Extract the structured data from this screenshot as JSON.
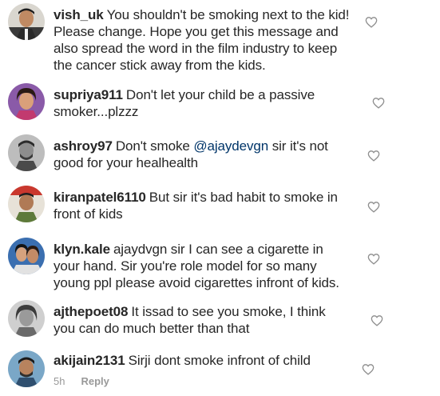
{
  "comments": [
    {
      "username": "vish_uk",
      "text": "You shouldn't be smoking next to the kid! Please change. Hope you get this message and also spread the word in the film industry to keep the cancer stick away from the kids."
    },
    {
      "username": "supriya911",
      "text": "Don't let your child be a passive smoker...plzzz"
    },
    {
      "username": "ashroy97",
      "text_before": "Don't smoke ",
      "mention": "@ajaydevgn",
      "text_after": " sir it's not good for your healhealth"
    },
    {
      "username": "kiranpatel6110",
      "text": "But sir it's bad habit to smoke in front of kids"
    },
    {
      "username": "klyn.kale",
      "text": "ajaydvgn sir I can see a cigarette in your hand. Sir you're role model for so many young ppl please avoid cigarettes infront of kids."
    },
    {
      "username": "ajthepoet08",
      "text": "It issad to see you smoke, I think you can do much better than that"
    },
    {
      "username": "akijain2131",
      "text": "Sirji dont smoke infront of child",
      "time": "5h",
      "reply_label": "Reply"
    }
  ],
  "icons": {
    "like": "heart-outline-icon"
  },
  "colors": {
    "text": "#262626",
    "mention": "#003569",
    "meta": "#999999",
    "heart": "#8e8e8e"
  }
}
